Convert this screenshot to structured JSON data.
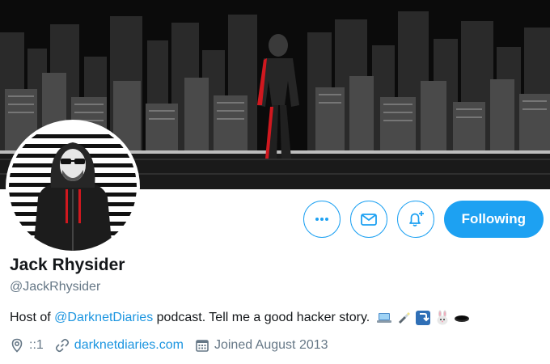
{
  "profile": {
    "name": "Jack Rhysider",
    "handle": "@JackRhysider",
    "bio": {
      "prefix": "Host of ",
      "mention": "@DarknetDiaries",
      "suffix": " podcast. Tell me a good hacker story.",
      "emojis": [
        "laptop-icon",
        "flashlight-icon",
        "return-arrow-icon",
        "rabbit-icon",
        "hole-icon"
      ]
    },
    "location": "::1",
    "website": "darknetdiaries.com",
    "joined": "Joined August 2013"
  },
  "actions": {
    "more_icon": "more-icon",
    "message_icon": "mail-icon",
    "notify_icon": "bell-plus-icon",
    "follow_label": "Following"
  },
  "colors": {
    "accent": "#1da1f2",
    "link": "#1b95e0",
    "muted": "#657786",
    "banner_bg": "#0b0b0b",
    "accent_red": "#d0181f"
  }
}
